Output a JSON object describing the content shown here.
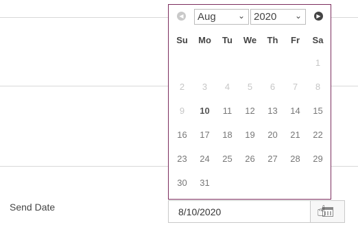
{
  "form": {
    "send_date_label": "Send Date",
    "date_value": "8/10/2020"
  },
  "picker": {
    "month": "Aug",
    "year": "2020",
    "weekdays": [
      "Su",
      "Mo",
      "Tu",
      "We",
      "Th",
      "Fr",
      "Sa"
    ],
    "weeks": [
      [
        "",
        "",
        "",
        "",
        "",
        "",
        "1"
      ],
      [
        "2",
        "3",
        "4",
        "5",
        "6",
        "7",
        "8"
      ],
      [
        "9",
        "10",
        "11",
        "12",
        "13",
        "14",
        "15"
      ],
      [
        "16",
        "17",
        "18",
        "19",
        "20",
        "21",
        "22"
      ],
      [
        "23",
        "24",
        "25",
        "26",
        "27",
        "28",
        "29"
      ],
      [
        "30",
        "31",
        "",
        "",
        "",
        "",
        ""
      ]
    ],
    "disabled_days": [
      "1",
      "2",
      "3",
      "4",
      "5",
      "6",
      "7",
      "8",
      "9"
    ],
    "selected_day": "10"
  },
  "colors": {
    "popup_border": "#7a2a5c",
    "dim_text": "#c6c6c6"
  },
  "icons": {
    "prev": "chevron-left-icon",
    "next": "chevron-right-icon",
    "calendar": "calendar-icon",
    "cursor": "hand-pointer-icon"
  }
}
